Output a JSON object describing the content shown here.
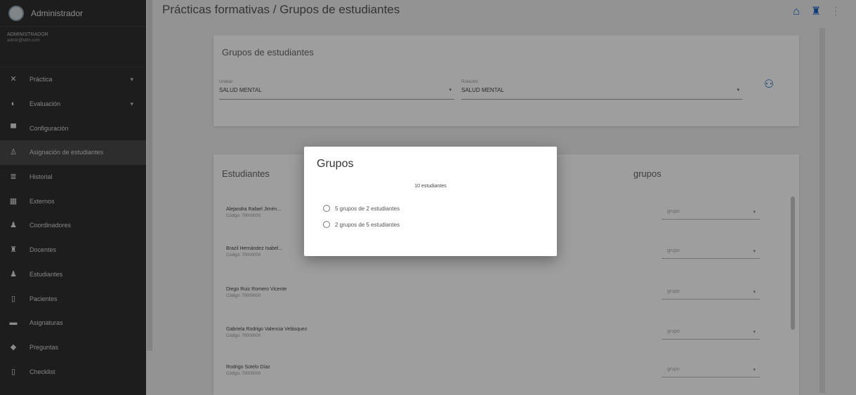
{
  "sidebar": {
    "title": "Administrador",
    "user_name": "ADMINISTRADOR",
    "user_email": "admin@tdlm.com",
    "items": [
      {
        "label": "Práctica",
        "icon": "tools-icon",
        "glyph": "✕",
        "caret": "▾"
      },
      {
        "label": "Evaluación",
        "icon": "clipboard-icon",
        "glyph": "◐",
        "caret": "▾"
      },
      {
        "label": "Configuración",
        "icon": "settings-icon",
        "glyph": "▀"
      },
      {
        "label": "Asignación de estudiantes",
        "icon": "assign-icon",
        "glyph": "♙",
        "active": true
      },
      {
        "label": "Historial",
        "icon": "history-icon",
        "glyph": "≣"
      },
      {
        "label": "Externos",
        "icon": "calendar-icon",
        "glyph": "▦"
      },
      {
        "label": "Coordinadores",
        "icon": "coordinator-icon",
        "glyph": "♟"
      },
      {
        "label": "Docentes",
        "icon": "teacher-icon",
        "glyph": "♜"
      },
      {
        "label": "Estudiantes",
        "icon": "student-icon",
        "glyph": "♟"
      },
      {
        "label": "Pacientes",
        "icon": "patient-icon",
        "glyph": "▯"
      },
      {
        "label": "Asignaturas",
        "icon": "subject-icon",
        "glyph": "▬"
      },
      {
        "label": "Preguntas",
        "icon": "question-icon",
        "glyph": "◆"
      },
      {
        "label": "Checklist",
        "icon": "checklist-icon",
        "glyph": "▯"
      }
    ]
  },
  "header": {
    "title": "Prácticas formativas / Grupos de estudiantes"
  },
  "filters": {
    "title": "Grupos de estudiantes",
    "select1": {
      "label": "Unidad",
      "value": "SALUD MENTAL"
    },
    "select2": {
      "label": "Rotación",
      "value": "SALUD MENTAL"
    }
  },
  "students": {
    "left_title": "Estudiantes",
    "right_title": "grupos",
    "group_placeholder": "grupo",
    "rows": [
      {
        "name": "Alejandra Rafael Jimén...",
        "code": "Código: 70000000"
      },
      {
        "name": "Brazil Hernández Isabel...",
        "code": "Código: 70000000"
      },
      {
        "name": "Diego Ruiz Romero Vicente",
        "code": "Código: 70000000"
      },
      {
        "name": "Gabriela Rodrigo Valencia Velásquez",
        "code": "Código: 70000000"
      },
      {
        "name": "Rodrigo Sotelo Díaz",
        "code": "Código: 70000000"
      }
    ]
  },
  "modal": {
    "title": "Grupos",
    "subtitle": "10 estudiantes",
    "options": [
      "5 grupos de 2 estudiantes",
      "2 grupos de 5 estudiantes"
    ]
  },
  "colors": {
    "sidebar_bg": "#2f2f2f",
    "accent": "#1565c0",
    "overlay": "rgba(0,0,0,0.38)"
  }
}
